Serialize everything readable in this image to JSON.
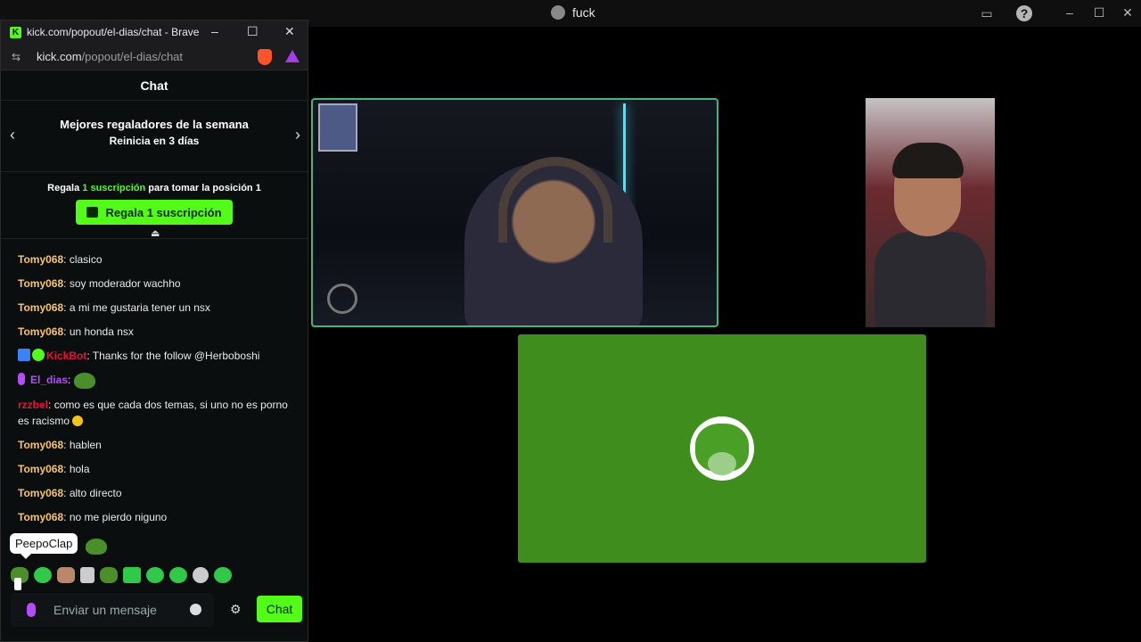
{
  "discord": {
    "call_title": "fuck",
    "colors": {
      "speaking_border": "#43b581",
      "tile_green": "#3f8e1d"
    }
  },
  "browser": {
    "window_title": "kick.com/popout/el-dias/chat - Brave",
    "url_host": "kick.com",
    "url_path": "/popout/el-dias/chat",
    "brave_shield_count": "1"
  },
  "chat": {
    "header": "Chat",
    "leaders_title": "Mejores regaladores de la semana",
    "leaders_subtitle": "Reinicia en 3 días",
    "gift_prefix": "Regala",
    "gift_highlight": "1 suscripción",
    "gift_suffix": "para tomar la posición 1",
    "gift_button": "Regala 1 suscripción",
    "messages": [
      {
        "user": "Tomy068",
        "sep": ": ",
        "text": "clasico",
        "color": "#f7c46c"
      },
      {
        "user": "Tomy068",
        "sep": ": ",
        "text": "soy moderador wachho",
        "color": "#f7c46c"
      },
      {
        "user": "Tomy068",
        "sep": ": ",
        "text": "a mi me gustaria tener un nsx",
        "color": "#f7c46c"
      },
      {
        "user": "Tomy068",
        "sep": ": ",
        "text": "un honda nsx",
        "color": "#f7c46c"
      },
      {
        "user": "KickBot",
        "sep": ": ",
        "text": "Thanks for the follow @Herboboshi",
        "color": "#e9113c"
      },
      {
        "user": "El_dias",
        "sep": ": ",
        "text": "",
        "color": "#b54cf7"
      },
      {
        "user": "rzzbel",
        "sep": ": ",
        "text": "como es que cada dos temas, si uno no es porno es racismo",
        "color": "#e9113c"
      },
      {
        "user": "Tomy068",
        "sep": ": ",
        "text": "hablen",
        "color": "#f7c46c"
      },
      {
        "user": "Tomy068",
        "sep": ": ",
        "text": "hola",
        "color": "#f7c46c"
      },
      {
        "user": "Tomy068",
        "sep": ": ",
        "text": "alto directo",
        "color": "#f7c46c"
      },
      {
        "user": "Tomy068",
        "sep": ": ",
        "text": "no me pierdo niguno",
        "color": "#f7c46c"
      }
    ],
    "tooltip": "PeepoClap",
    "input_placeholder": "Enviar un mensaje",
    "send_button": "Chat",
    "accent": "#53fc18"
  }
}
